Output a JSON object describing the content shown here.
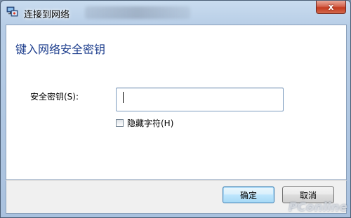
{
  "window": {
    "title": "连接到网络",
    "close_label": "x",
    "close_icon": "close-icon"
  },
  "dialog": {
    "heading": "键入网络安全密钥",
    "key_field": {
      "label": "安全密钥(S):",
      "value": "",
      "placeholder": ""
    },
    "hide_characters": {
      "label": "隐藏字符(H)",
      "checked": false
    }
  },
  "buttons": {
    "ok_label": "确定",
    "cancel_label": "取消"
  },
  "watermark": {
    "text": "PConline"
  },
  "colors": {
    "heading": "#1b3c8c",
    "titlebar": "#b7cde6",
    "close_button": "#c43a1f",
    "default_button_border": "#3c7fb1"
  }
}
